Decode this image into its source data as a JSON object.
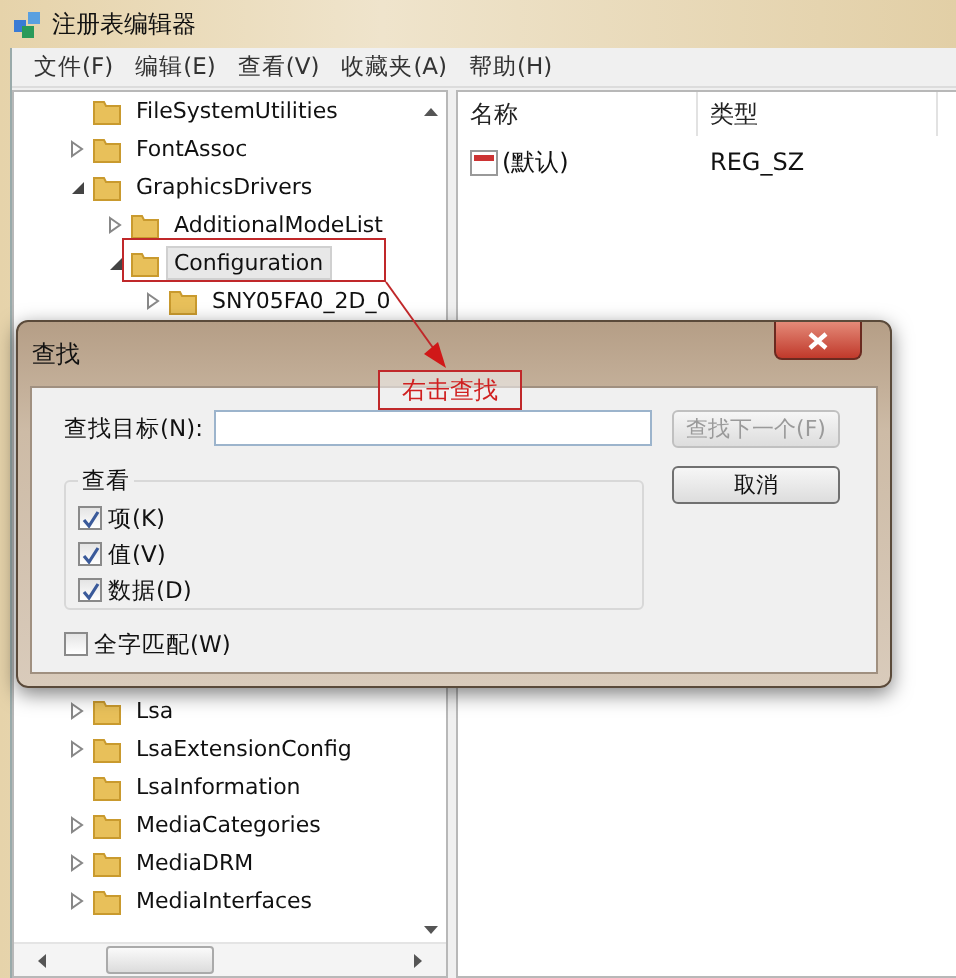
{
  "window": {
    "title": "注册表编辑器"
  },
  "menu": [
    "文件(F)",
    "编辑(E)",
    "查看(V)",
    "收藏夹(A)",
    "帮助(H)"
  ],
  "tree": {
    "items_above": [
      {
        "label": "FileSystemUtilities",
        "kind": "leaf",
        "selected": false
      },
      {
        "label": "FontAssoc",
        "kind": "collapsed",
        "selected": false
      },
      {
        "label": "GraphicsDrivers",
        "kind": "expanded",
        "selected": false,
        "children": [
          {
            "label": "AdditionalModeList",
            "kind": "collapsed",
            "selected": false
          },
          {
            "label": "Configuration",
            "kind": "expanded",
            "selected": true,
            "children": [
              {
                "label": "SNY05FA0_2D_0",
                "kind": "collapsed",
                "selected": false
              }
            ]
          }
        ]
      }
    ],
    "items_below": [
      {
        "label": "Lsa",
        "kind": "collapsed",
        "selected": false
      },
      {
        "label": "LsaExtensionConfig",
        "kind": "collapsed",
        "selected": false
      },
      {
        "label": "LsaInformation",
        "kind": "leaf",
        "selected": false
      },
      {
        "label": "MediaCategories",
        "kind": "collapsed",
        "selected": false
      },
      {
        "label": "MediaDRM",
        "kind": "collapsed",
        "selected": false
      },
      {
        "label": "MediaInterfaces",
        "kind": "collapsed",
        "selected": false
      }
    ]
  },
  "values": {
    "columns": [
      "名称",
      "类型"
    ],
    "rows": [
      {
        "name": "(默认)",
        "type": "REG_SZ"
      }
    ]
  },
  "dialog": {
    "title": "查找",
    "find_label": "查找目标(N):",
    "find_next": {
      "label": "查找下一个(F)",
      "disabled": true
    },
    "cancel": "取消",
    "group_title": "查看",
    "options": [
      {
        "label": "项(K)",
        "checked": true
      },
      {
        "label": "值(V)",
        "checked": true
      },
      {
        "label": "数据(D)",
        "checked": true
      }
    ],
    "whole_word": {
      "label": "全字匹配(W)",
      "checked": false
    }
  },
  "annotation": {
    "text": "右击查找"
  }
}
